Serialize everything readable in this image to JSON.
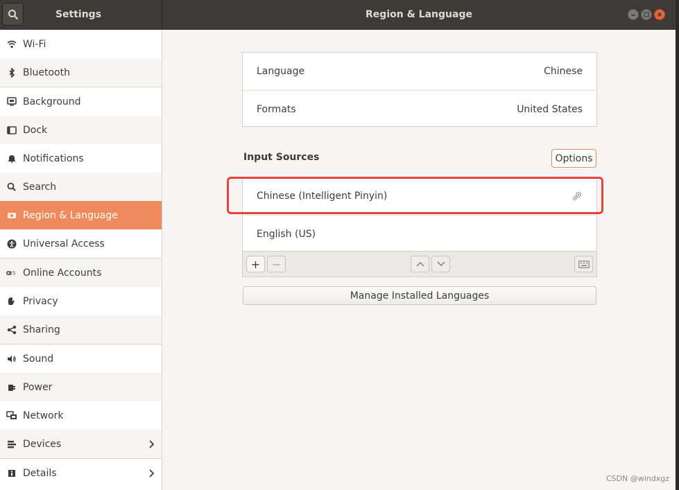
{
  "header": {
    "left_title": "Settings",
    "main_title": "Region & Language"
  },
  "sidebar": {
    "items": [
      {
        "label": "Wi-Fi",
        "icon": "wifi-icon"
      },
      {
        "label": "Bluetooth",
        "icon": "bluetooth-icon"
      },
      {
        "label": "Background",
        "icon": "background-icon"
      },
      {
        "label": "Dock",
        "icon": "dock-icon"
      },
      {
        "label": "Notifications",
        "icon": "bell-icon"
      },
      {
        "label": "Search",
        "icon": "search-icon"
      },
      {
        "label": "Region & Language",
        "icon": "flag-icon",
        "active": true
      },
      {
        "label": "Universal Access",
        "icon": "accessibility-icon"
      },
      {
        "label": "Online Accounts",
        "icon": "online-accounts-icon"
      },
      {
        "label": "Privacy",
        "icon": "hand-icon"
      },
      {
        "label": "Sharing",
        "icon": "share-icon"
      },
      {
        "label": "Sound",
        "icon": "speaker-icon"
      },
      {
        "label": "Power",
        "icon": "power-icon"
      },
      {
        "label": "Network",
        "icon": "network-icon"
      },
      {
        "label": "Devices",
        "icon": "devices-icon",
        "chevron": true
      },
      {
        "label": "Details",
        "icon": "info-icon",
        "chevron": true
      }
    ]
  },
  "main": {
    "language": {
      "label": "Language",
      "value": "Chinese"
    },
    "formats": {
      "label": "Formats",
      "value": "United States"
    },
    "input_sources_title": "Input Sources",
    "options_label": "Options",
    "input_sources": [
      {
        "label": "Chinese (Intelligent Pinyin)"
      },
      {
        "label": "English (US)"
      }
    ],
    "toolbar": {
      "add": "+",
      "remove": "−"
    },
    "manage_label": "Manage Installed Languages"
  },
  "colors": {
    "active": "#f08a5c",
    "highlight": "#e8403a",
    "header": "#3c3b37"
  },
  "watermark": "CSDN @windxgz"
}
